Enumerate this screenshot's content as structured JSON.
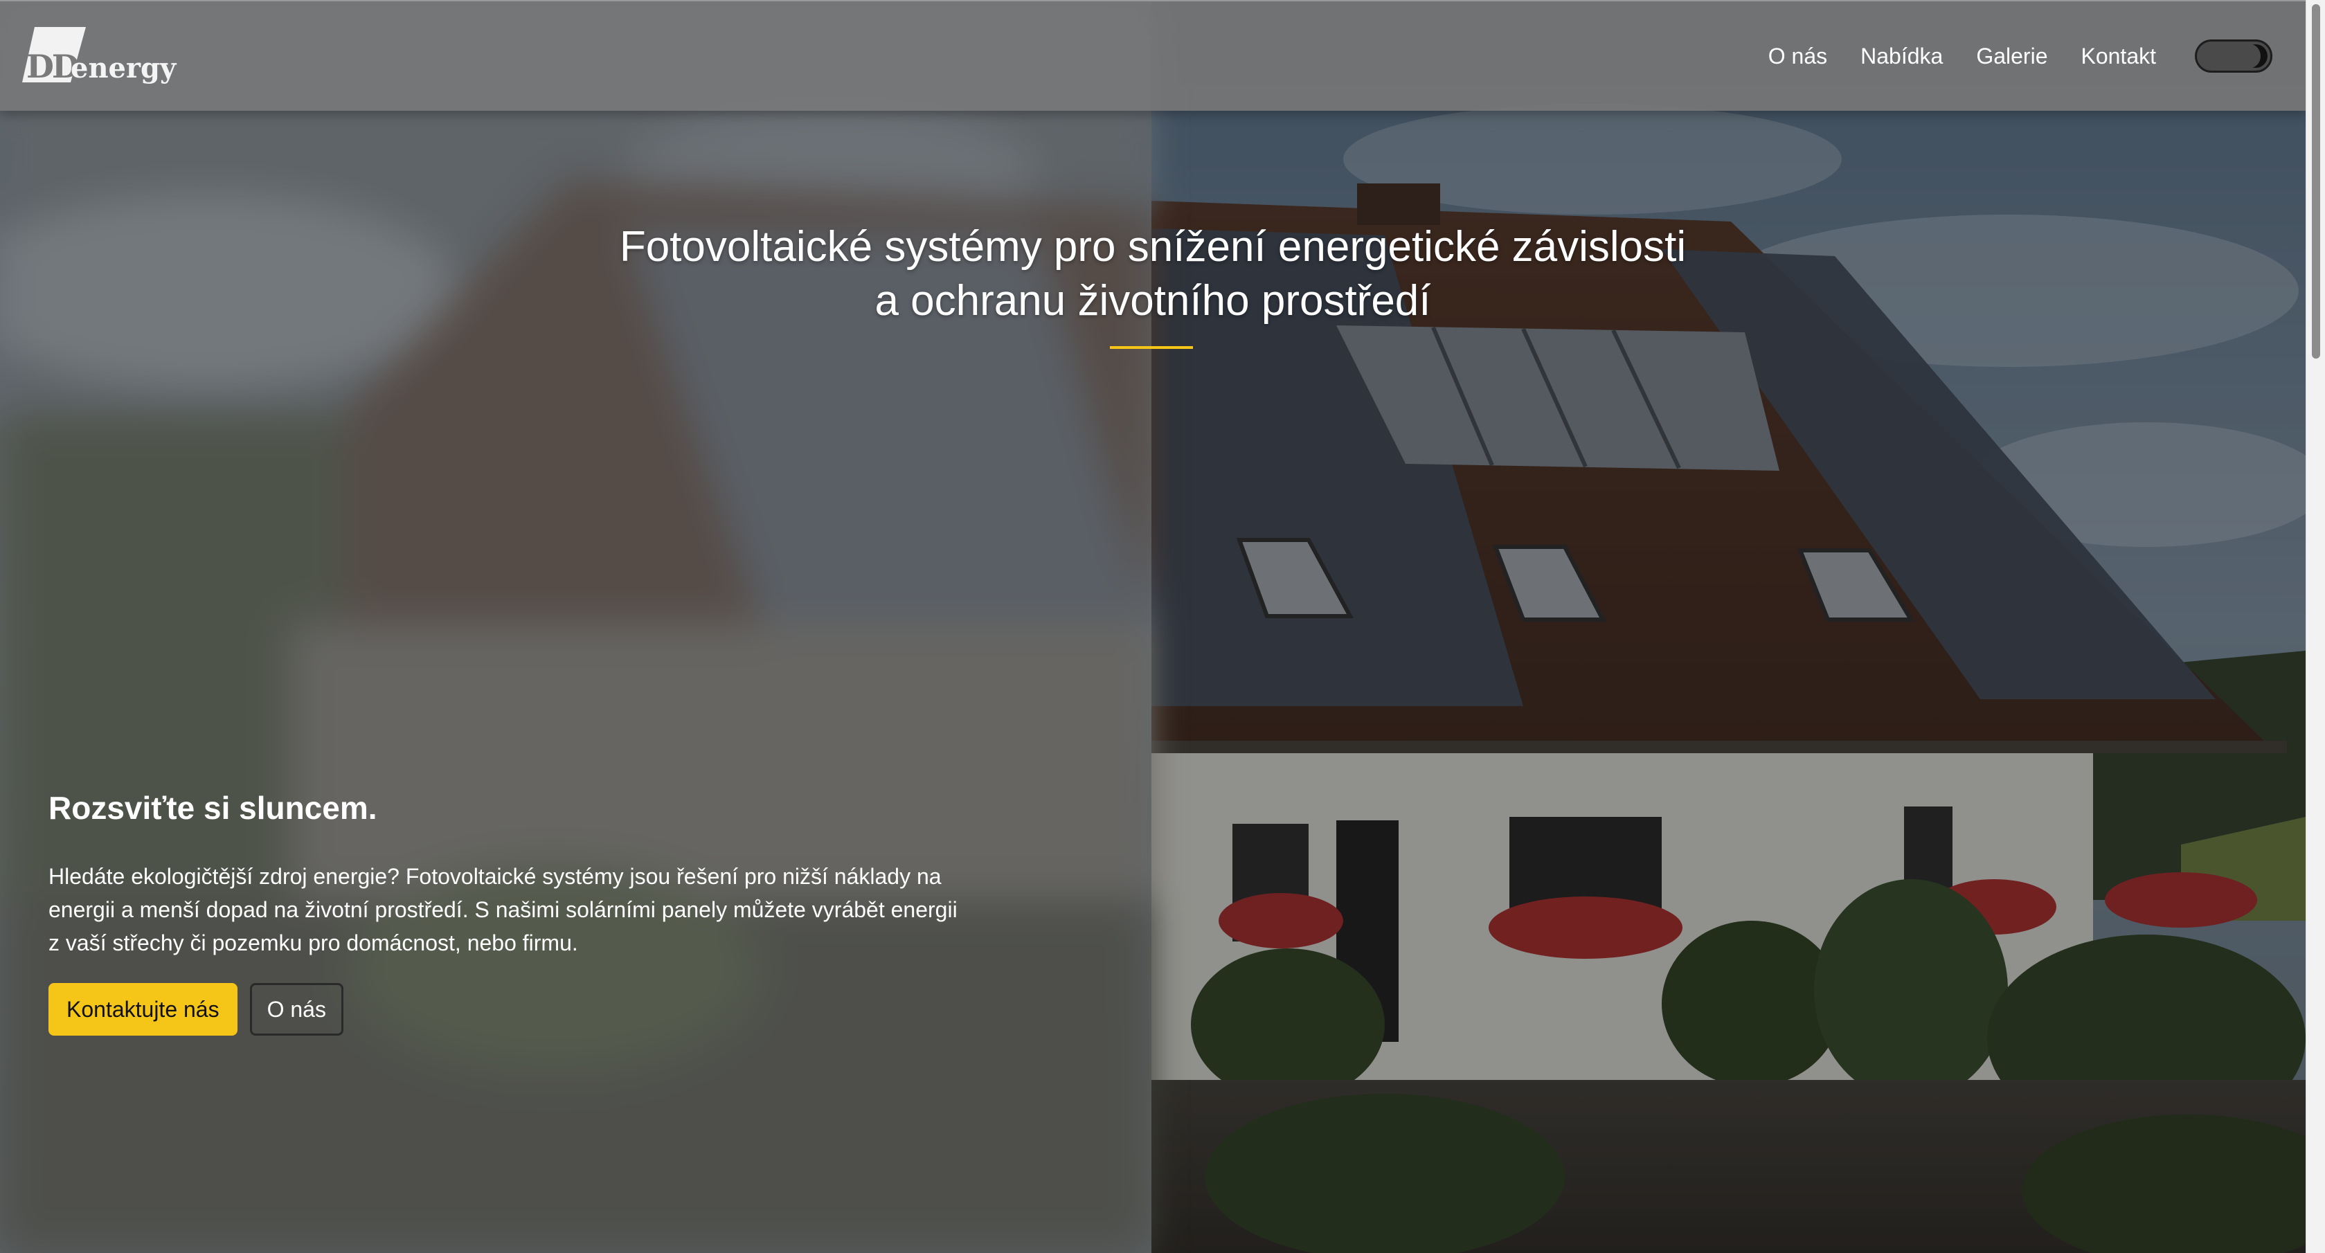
{
  "header": {
    "logo_mark": "DD",
    "logo_word": "energy",
    "nav": [
      "O nás",
      "Nabídka",
      "Galerie",
      "Kontakt"
    ],
    "theme_toggle": "dark-mode-toggle"
  },
  "hero": {
    "headline_line1": "Fotovoltaické systémy pro snížení energetické závislosti",
    "headline_line2": "a ochranu životního prostředí",
    "accent_color": "#f5c518"
  },
  "intro": {
    "title": "Rozsviťte si sluncem.",
    "text_line1": "Hledáte ekologičtější zdroj energie? Fotovoltaické systémy jsou řešení pro nižší náklady na",
    "text_line2": "energii a menší dopad na životní prostředí. S našimi solárními panely můžete vyrábět energii",
    "text_line3": "z vaší střechy či pozemku pro domácnost, nebo firmu.",
    "cta_primary": "Kontaktujte nás",
    "cta_secondary": "O nás"
  }
}
